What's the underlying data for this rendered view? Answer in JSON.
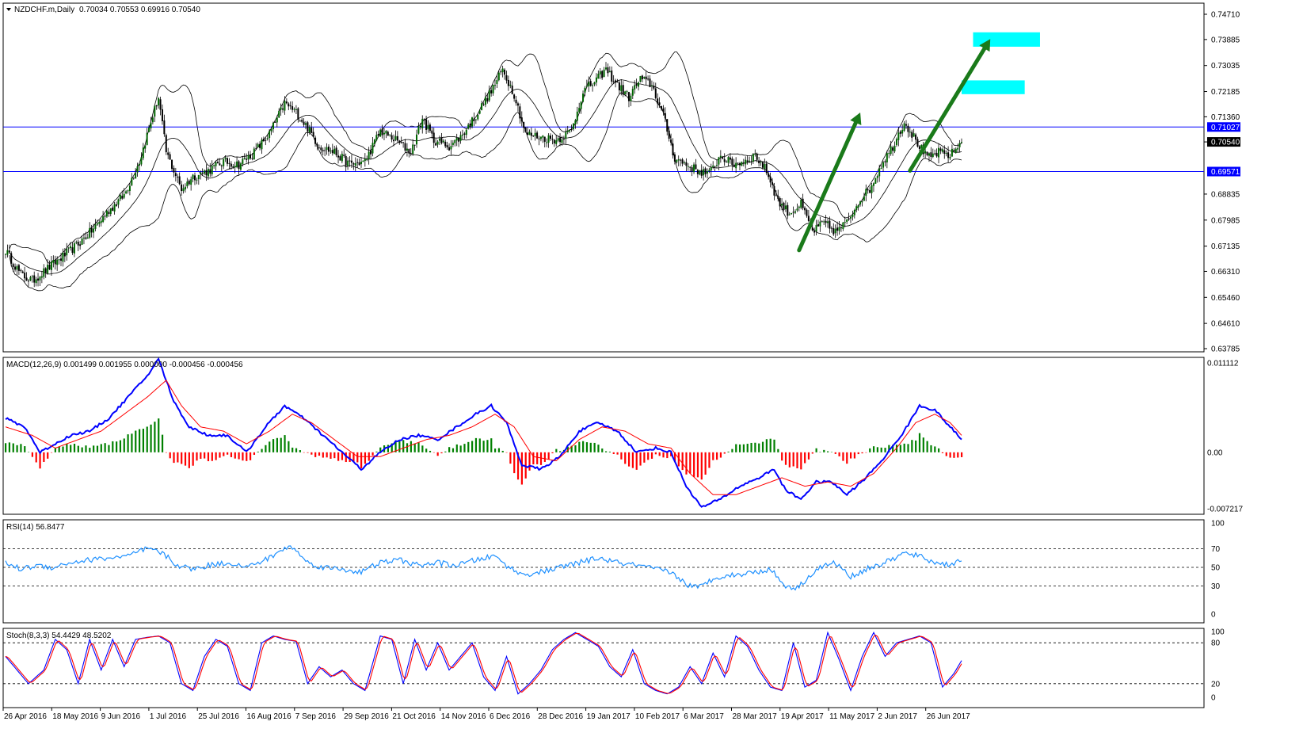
{
  "colors": {
    "background": "#ffffff",
    "grid_frame": "#000000",
    "bull_candle": "#006400",
    "bear_candle": "#000000",
    "bollinger": "#000000",
    "hline": "#0000ff",
    "macd_line": "#0000ff",
    "signal_line": "#ff0000",
    "hist_pos": "#008000",
    "hist_neg": "#ff0000",
    "rsi": "#1e90ff",
    "stoch_main": "#0000ff",
    "stoch_signal": "#ff0000",
    "arrow": "#1a7a1a",
    "target_box": "#00ffff"
  },
  "header": {
    "symbol_text": "NZDCHF.m,Daily",
    "ohlc_text": "0.70034 0.70553 0.69916 0.70540"
  },
  "main_pane": {
    "y_ticks": [
      "0.74710",
      "0.73885",
      "0.73035",
      "0.72185",
      "0.71360",
      "0.70540",
      "0.68835",
      "0.67985",
      "0.67135",
      "0.66310",
      "0.65460",
      "0.64610",
      "0.63785"
    ],
    "y_tick_values": [
      0.7471,
      0.73885,
      0.73035,
      0.72185,
      0.7136,
      0.7054,
      0.68835,
      0.67985,
      0.67135,
      0.6631,
      0.6546,
      0.6461,
      0.63785
    ],
    "price_tags": [
      {
        "text": "0.71027",
        "value": 0.71027,
        "style": "blue"
      },
      {
        "text": "0.70540",
        "value": 0.7054,
        "style": "black"
      },
      {
        "text": "0.69571",
        "value": 0.69571,
        "style": "blue"
      }
    ]
  },
  "macd_pane": {
    "label": "MACD(12,26,9) 0.001499 0.001955 0.000000 -0.000456 -0.000456",
    "y_ticks": [
      "0.011112",
      "0.00",
      "-0.007217"
    ]
  },
  "rsi_pane": {
    "label": "RSI(14) 56.8477",
    "y_ticks": [
      "100",
      "70",
      "50",
      "30",
      "0"
    ],
    "levels": [
      70,
      50,
      30
    ]
  },
  "stoch_pane": {
    "label": "Stoch(8,3,3) 54.4429 48.5202",
    "y_ticks": [
      "100",
      "80",
      "20",
      "0"
    ],
    "levels": [
      80,
      20
    ]
  },
  "x_axis": {
    "date_labels": [
      "26 Apr 2016",
      "18 May 2016",
      "9 Jun 2016",
      "1 Jul 2016",
      "25 Jul 2016",
      "16 Aug 2016",
      "7 Sep 2016",
      "29 Sep 2016",
      "21 Oct 2016",
      "14 Nov 2016",
      "6 Dec 2016",
      "28 Dec 2016",
      "19 Jan 2017",
      "10 Feb 2017",
      "6 Mar 2017",
      "28 Mar 2017",
      "19 Apr 2017",
      "11 May 2017",
      "2 Jun 2017",
      "26 Jun 2017"
    ]
  },
  "chart_data": {
    "type": "candlestick",
    "title": "NZDCHF.m,Daily",
    "ylim": [
      0.63785,
      0.7471
    ],
    "horizontal_lines": [
      0.71027,
      0.69571
    ],
    "close_anchors": [
      [
        0,
        0.67
      ],
      [
        8,
        0.662
      ],
      [
        14,
        0.66
      ],
      [
        22,
        0.664
      ],
      [
        30,
        0.668
      ],
      [
        38,
        0.672
      ],
      [
        46,
        0.677
      ],
      [
        54,
        0.683
      ],
      [
        62,
        0.688
      ],
      [
        70,
        0.699
      ],
      [
        76,
        0.712
      ],
      [
        80,
        0.72
      ],
      [
        84,
        0.702
      ],
      [
        88,
        0.696
      ],
      [
        92,
        0.69
      ],
      [
        98,
        0.694
      ],
      [
        106,
        0.696
      ],
      [
        114,
        0.699
      ],
      [
        122,
        0.698
      ],
      [
        130,
        0.702
      ],
      [
        138,
        0.708
      ],
      [
        146,
        0.718
      ],
      [
        152,
        0.715
      ],
      [
        158,
        0.71
      ],
      [
        164,
        0.704
      ],
      [
        172,
        0.702
      ],
      [
        180,
        0.698
      ],
      [
        188,
        0.699
      ],
      [
        196,
        0.709
      ],
      [
        204,
        0.706
      ],
      [
        212,
        0.702
      ],
      [
        218,
        0.713
      ],
      [
        224,
        0.706
      ],
      [
        232,
        0.704
      ],
      [
        238,
        0.707
      ],
      [
        246,
        0.714
      ],
      [
        254,
        0.722
      ],
      [
        260,
        0.729
      ],
      [
        266,
        0.721
      ],
      [
        272,
        0.708
      ],
      [
        280,
        0.707
      ],
      [
        288,
        0.706
      ],
      [
        296,
        0.709
      ],
      [
        302,
        0.722
      ],
      [
        308,
        0.725
      ],
      [
        314,
        0.729
      ],
      [
        320,
        0.724
      ],
      [
        326,
        0.72
      ],
      [
        332,
        0.726
      ],
      [
        338,
        0.724
      ],
      [
        344,
        0.714
      ],
      [
        350,
        0.7
      ],
      [
        356,
        0.698
      ],
      [
        362,
        0.696
      ],
      [
        368,
        0.695
      ],
      [
        374,
        0.701
      ],
      [
        380,
        0.698
      ],
      [
        386,
        0.699
      ],
      [
        392,
        0.701
      ],
      [
        398,
        0.696
      ],
      [
        404,
        0.686
      ],
      [
        410,
        0.682
      ],
      [
        416,
        0.685
      ],
      [
        422,
        0.676
      ],
      [
        428,
        0.679
      ],
      [
        434,
        0.676
      ],
      [
        440,
        0.679
      ],
      [
        446,
        0.686
      ],
      [
        452,
        0.69
      ],
      [
        458,
        0.698
      ],
      [
        464,
        0.704
      ],
      [
        470,
        0.712
      ],
      [
        476,
        0.706
      ],
      [
        482,
        0.7
      ],
      [
        488,
        0.702
      ],
      [
        494,
        0.701
      ],
      [
        500,
        0.7054
      ]
    ],
    "macd_line_anchors": [
      [
        0,
        0.004
      ],
      [
        10,
        0.003
      ],
      [
        18,
        0.0
      ],
      [
        26,
        0.001
      ],
      [
        34,
        0.002
      ],
      [
        44,
        0.0025
      ],
      [
        54,
        0.004
      ],
      [
        64,
        0.0065
      ],
      [
        74,
        0.009
      ],
      [
        80,
        0.011
      ],
      [
        88,
        0.006
      ],
      [
        96,
        0.003
      ],
      [
        106,
        0.002
      ],
      [
        116,
        0.002
      ],
      [
        126,
        0.0
      ],
      [
        136,
        0.003
      ],
      [
        146,
        0.0055
      ],
      [
        156,
        0.004
      ],
      [
        166,
        0.002
      ],
      [
        176,
        0.0
      ],
      [
        186,
        -0.002
      ],
      [
        196,
        0.0
      ],
      [
        206,
        0.0015
      ],
      [
        216,
        0.002
      ],
      [
        226,
        0.0015
      ],
      [
        236,
        0.003
      ],
      [
        246,
        0.0045
      ],
      [
        254,
        0.0055
      ],
      [
        262,
        0.0035
      ],
      [
        270,
        -0.0015
      ],
      [
        280,
        -0.002
      ],
      [
        290,
        -0.0005
      ],
      [
        300,
        0.0025
      ],
      [
        310,
        0.0035
      ],
      [
        320,
        0.0025
      ],
      [
        330,
        0.0
      ],
      [
        340,
        0.0005
      ],
      [
        348,
        0.0
      ],
      [
        356,
        -0.004
      ],
      [
        364,
        -0.0065
      ],
      [
        374,
        -0.0055
      ],
      [
        384,
        -0.004
      ],
      [
        394,
        -0.003
      ],
      [
        402,
        -0.002
      ],
      [
        408,
        -0.0045
      ],
      [
        416,
        -0.0055
      ],
      [
        424,
        -0.0035
      ],
      [
        432,
        -0.0035
      ],
      [
        440,
        -0.005
      ],
      [
        450,
        -0.003
      ],
      [
        460,
        -0.0005
      ],
      [
        470,
        0.0025
      ],
      [
        478,
        0.0055
      ],
      [
        486,
        0.005
      ],
      [
        494,
        0.003
      ],
      [
        500,
        0.0015
      ]
    ],
    "macd_signal_anchors": [
      [
        0,
        0.003
      ],
      [
        14,
        0.002
      ],
      [
        26,
        0.0005
      ],
      [
        38,
        0.0015
      ],
      [
        50,
        0.0025
      ],
      [
        62,
        0.0045
      ],
      [
        74,
        0.0065
      ],
      [
        84,
        0.0085
      ],
      [
        92,
        0.0055
      ],
      [
        102,
        0.003
      ],
      [
        114,
        0.0025
      ],
      [
        126,
        0.001
      ],
      [
        138,
        0.0025
      ],
      [
        150,
        0.0045
      ],
      [
        160,
        0.0035
      ],
      [
        172,
        0.0015
      ],
      [
        184,
        -0.0005
      ],
      [
        196,
        -0.0005
      ],
      [
        208,
        0.0005
      ],
      [
        220,
        0.0015
      ],
      [
        232,
        0.002
      ],
      [
        244,
        0.003
      ],
      [
        256,
        0.0045
      ],
      [
        266,
        0.003
      ],
      [
        276,
        -0.0005
      ],
      [
        288,
        -0.001
      ],
      [
        300,
        0.0015
      ],
      [
        312,
        0.003
      ],
      [
        324,
        0.0025
      ],
      [
        336,
        0.001
      ],
      [
        348,
        0.0005
      ],
      [
        358,
        -0.0025
      ],
      [
        370,
        -0.005
      ],
      [
        382,
        -0.005
      ],
      [
        394,
        -0.004
      ],
      [
        406,
        -0.003
      ],
      [
        418,
        -0.004
      ],
      [
        430,
        -0.0035
      ],
      [
        442,
        -0.004
      ],
      [
        454,
        -0.0025
      ],
      [
        466,
        0.0005
      ],
      [
        476,
        0.0035
      ],
      [
        486,
        0.0045
      ],
      [
        494,
        0.0035
      ],
      [
        500,
        0.002
      ]
    ],
    "rsi_anchors": [
      [
        0,
        55
      ],
      [
        8,
        48
      ],
      [
        16,
        52
      ],
      [
        24,
        50
      ],
      [
        34,
        55
      ],
      [
        44,
        58
      ],
      [
        54,
        60
      ],
      [
        64,
        62
      ],
      [
        74,
        70
      ],
      [
        82,
        65
      ],
      [
        90,
        52
      ],
      [
        98,
        48
      ],
      [
        108,
        53
      ],
      [
        118,
        55
      ],
      [
        126,
        50
      ],
      [
        136,
        58
      ],
      [
        146,
        70
      ],
      [
        150,
        72
      ],
      [
        158,
        55
      ],
      [
        166,
        50
      ],
      [
        176,
        48
      ],
      [
        186,
        45
      ],
      [
        196,
        55
      ],
      [
        206,
        58
      ],
      [
        216,
        52
      ],
      [
        226,
        55
      ],
      [
        236,
        52
      ],
      [
        246,
        58
      ],
      [
        256,
        62
      ],
      [
        262,
        52
      ],
      [
        270,
        42
      ],
      [
        280,
        45
      ],
      [
        290,
        50
      ],
      [
        300,
        55
      ],
      [
        310,
        60
      ],
      [
        320,
        55
      ],
      [
        330,
        52
      ],
      [
        340,
        48
      ],
      [
        348,
        45
      ],
      [
        356,
        32
      ],
      [
        362,
        28
      ],
      [
        372,
        40
      ],
      [
        382,
        42
      ],
      [
        392,
        45
      ],
      [
        400,
        48
      ],
      [
        408,
        30
      ],
      [
        414,
        28
      ],
      [
        420,
        40
      ],
      [
        426,
        50
      ],
      [
        434,
        55
      ],
      [
        442,
        40
      ],
      [
        450,
        48
      ],
      [
        460,
        55
      ],
      [
        470,
        65
      ],
      [
        478,
        62
      ],
      [
        486,
        55
      ],
      [
        494,
        53
      ],
      [
        500,
        57
      ]
    ],
    "stoch_main_anchors": [
      [
        0,
        60
      ],
      [
        6,
        40
      ],
      [
        12,
        20
      ],
      [
        20,
        40
      ],
      [
        26,
        85
      ],
      [
        32,
        70
      ],
      [
        38,
        20
      ],
      [
        44,
        85
      ],
      [
        50,
        40
      ],
      [
        56,
        85
      ],
      [
        62,
        45
      ],
      [
        68,
        85
      ],
      [
        74,
        88
      ],
      [
        80,
        90
      ],
      [
        86,
        80
      ],
      [
        92,
        20
      ],
      [
        98,
        10
      ],
      [
        104,
        60
      ],
      [
        110,
        85
      ],
      [
        116,
        75
      ],
      [
        122,
        20
      ],
      [
        128,
        10
      ],
      [
        134,
        80
      ],
      [
        140,
        90
      ],
      [
        146,
        85
      ],
      [
        152,
        82
      ],
      [
        158,
        20
      ],
      [
        164,
        45
      ],
      [
        170,
        30
      ],
      [
        176,
        40
      ],
      [
        182,
        20
      ],
      [
        188,
        10
      ],
      [
        196,
        90
      ],
      [
        202,
        85
      ],
      [
        208,
        20
      ],
      [
        214,
        85
      ],
      [
        220,
        40
      ],
      [
        226,
        80
      ],
      [
        232,
        40
      ],
      [
        238,
        60
      ],
      [
        244,
        80
      ],
      [
        250,
        30
      ],
      [
        256,
        10
      ],
      [
        262,
        60
      ],
      [
        268,
        5
      ],
      [
        274,
        20
      ],
      [
        280,
        40
      ],
      [
        286,
        70
      ],
      [
        292,
        85
      ],
      [
        298,
        95
      ],
      [
        304,
        85
      ],
      [
        310,
        75
      ],
      [
        316,
        45
      ],
      [
        322,
        30
      ],
      [
        328,
        70
      ],
      [
        334,
        20
      ],
      [
        340,
        10
      ],
      [
        346,
        5
      ],
      [
        352,
        15
      ],
      [
        358,
        45
      ],
      [
        364,
        20
      ],
      [
        370,
        65
      ],
      [
        376,
        30
      ],
      [
        382,
        90
      ],
      [
        388,
        75
      ],
      [
        394,
        40
      ],
      [
        400,
        15
      ],
      [
        406,
        10
      ],
      [
        412,
        80
      ],
      [
        418,
        15
      ],
      [
        424,
        25
      ],
      [
        430,
        95
      ],
      [
        436,
        55
      ],
      [
        442,
        10
      ],
      [
        448,
        60
      ],
      [
        454,
        95
      ],
      [
        460,
        60
      ],
      [
        466,
        80
      ],
      [
        472,
        85
      ],
      [
        478,
        90
      ],
      [
        484,
        80
      ],
      [
        490,
        15
      ],
      [
        496,
        35
      ],
      [
        500,
        54
      ]
    ],
    "markup": {
      "arrows": [
        {
          "from": [
            415,
            0.67
          ],
          "to": [
            447,
            0.715
          ]
        },
        {
          "from": [
            473,
            0.696
          ],
          "to": [
            515,
            0.739
          ]
        }
      ],
      "target_boxes": [
        {
          "x": [
            500,
            533
          ],
          "y": [
            0.721,
            0.7255
          ]
        },
        {
          "x": [
            506,
            541
          ],
          "y": [
            0.7365,
            0.7412
          ]
        }
      ]
    }
  }
}
